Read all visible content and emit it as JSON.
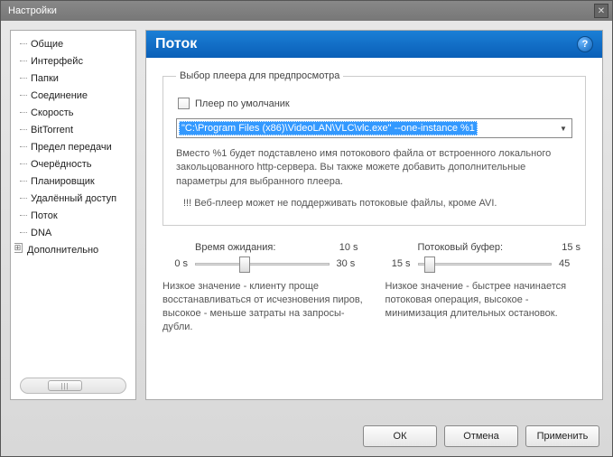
{
  "window": {
    "title": "Настройки"
  },
  "sidebar": {
    "items": [
      {
        "label": "Общие"
      },
      {
        "label": "Интерфейс"
      },
      {
        "label": "Папки"
      },
      {
        "label": "Соединение"
      },
      {
        "label": "Скорость"
      },
      {
        "label": "BitTorrent"
      },
      {
        "label": "Предел передачи"
      },
      {
        "label": "Очерёдность"
      },
      {
        "label": "Планировщик"
      },
      {
        "label": "Удалённый доступ"
      },
      {
        "label": "Поток"
      },
      {
        "label": "DNA"
      },
      {
        "label": "Дополнительно"
      }
    ]
  },
  "header": {
    "title": "Поток"
  },
  "panel": {
    "group_title": "Выбор плеера для предпросмотра",
    "default_player_label": "Плеер по умолчаник",
    "player_path": "\"C:\\Program Files (x86)\\VideoLAN\\VLC\\vlc.exe\" --one-instance %1",
    "description": "Вместо %1 будет подставлено имя потокового файла от встроенного локального закольцованного http-сервера. Вы также можете добавить дополнительные параметры для выбранного плеера.",
    "warning": "!!! Веб-плеер может не поддерживать потоковые файлы, кроме AVI."
  },
  "sliders": {
    "wait": {
      "title": "Время ожидания:",
      "value": "10 s",
      "min": "0 s",
      "max": "30 s",
      "desc": "Низкое значение - клиенту проще восстанавливаться от исчезновения пиров, высокое - меньше затраты на запросы-дубли.",
      "thumb_pct": 33
    },
    "buffer": {
      "title": "Потоковый буфер:",
      "value": "15 s",
      "min": "15 s",
      "max": "45",
      "desc": "Низкое значение - быстрее начинается потоковая операция, высокое - минимизация длительных остановок.",
      "thumb_pct": 5
    }
  },
  "buttons": {
    "ok": "ОК",
    "cancel": "Отмена",
    "apply": "Применить"
  }
}
